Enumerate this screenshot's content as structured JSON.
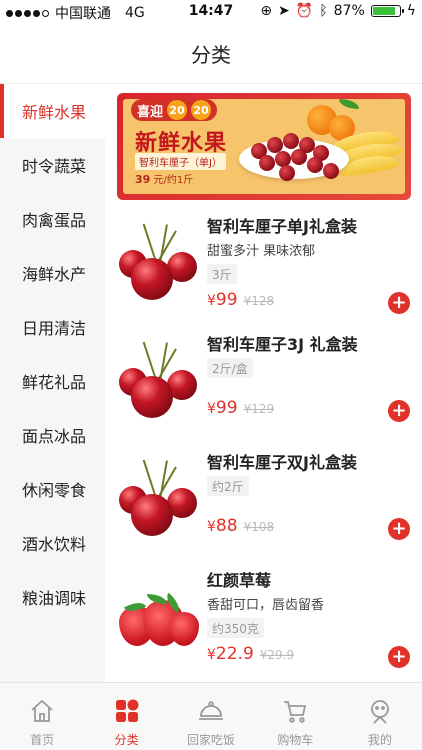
{
  "status_bar": {
    "carrier": "中国联通",
    "network": "4G",
    "time": "14:47",
    "battery": "87%",
    "battery_level": 0.87
  },
  "nav": {
    "title": "分类"
  },
  "sidebar": {
    "items": [
      {
        "label": "新鲜水果",
        "active": true
      },
      {
        "label": "时令蔬菜"
      },
      {
        "label": "肉禽蛋品"
      },
      {
        "label": "海鲜水产"
      },
      {
        "label": "日用清洁"
      },
      {
        "label": "鲜花礼品"
      },
      {
        "label": "面点冰品"
      },
      {
        "label": "休闲零食"
      },
      {
        "label": "酒水饮料"
      },
      {
        "label": "粮油调味"
      }
    ]
  },
  "banner": {
    "tag": "喜迎",
    "year_a": "20",
    "year_b": "20",
    "title": "新鲜水果",
    "subtitle": "智利车厘子（单J）",
    "price": "39",
    "price_unit": "元/约1斤"
  },
  "products": [
    {
      "name": "智利车厘子单J礼盒装",
      "desc": "甜蜜多汁 果味浓郁",
      "spec": "3斤",
      "currency": "¥",
      "price": "99",
      "old_price": "¥128",
      "image": "cherry"
    },
    {
      "name": "智利车厘子3J 礼盒装",
      "desc": "",
      "spec": "2斤/盒",
      "currency": "¥",
      "price": "99",
      "old_price": "¥129",
      "image": "cherry"
    },
    {
      "name": "智利车厘子双J礼盒装",
      "desc": "",
      "spec": "约2斤",
      "currency": "¥",
      "price": "88",
      "old_price": "¥108",
      "image": "cherry"
    },
    {
      "name": "红颜草莓",
      "desc": "香甜可口，唇齿留香",
      "spec": "约350克",
      "currency": "¥",
      "price": "22.9",
      "old_price": "¥29.9",
      "image": "strawberry"
    }
  ],
  "tab_bar": {
    "tabs": [
      {
        "label": "首页",
        "icon": "home-icon"
      },
      {
        "label": "分类",
        "icon": "category-icon",
        "active": true
      },
      {
        "label": "回家吃饭",
        "icon": "dish-icon"
      },
      {
        "label": "购物车",
        "icon": "cart-icon"
      },
      {
        "label": "我的",
        "icon": "profile-icon"
      }
    ]
  },
  "colors": {
    "accent": "#e0312b",
    "inactive": "#999999"
  }
}
